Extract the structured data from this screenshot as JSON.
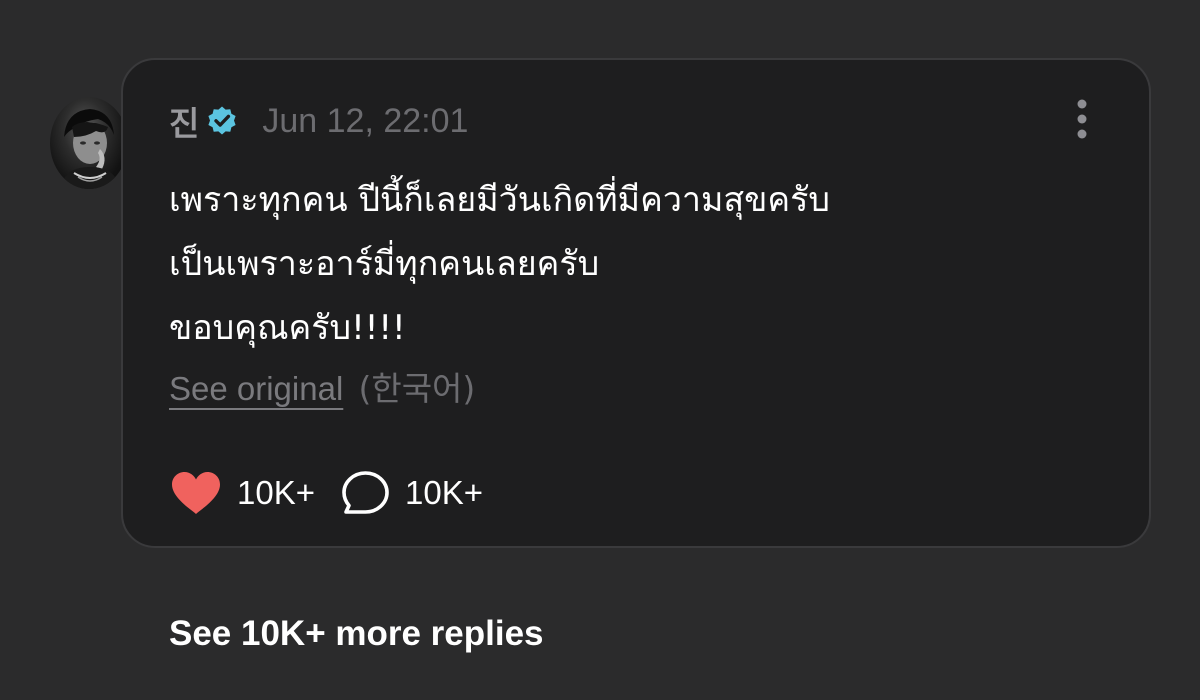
{
  "post": {
    "author": "진",
    "timestamp": "Jun 12, 22:01",
    "lines": [
      "เพราะทุกคน ปีนี้ก็เลยมีวันเกิดที่มีความสุขครับ",
      "เป็นเพราะอาร์มี่ทุกคนเลยครับ",
      "ขอบคุณครับ!!!!"
    ],
    "see_original": "See original",
    "original_language": "(한국어)",
    "like_count": "10K+",
    "comment_count": "10K+"
  },
  "replies": {
    "more_label": "See 10K+ more replies"
  },
  "colors": {
    "background": "#2b2b2c",
    "card": "#1e1e1f",
    "verified": "#5bc4e0",
    "like": "#f0625e"
  },
  "icons": {
    "verified": "verified-badge-icon",
    "more": "more-vertical-icon",
    "like": "heart-icon",
    "comment": "speech-bubble-icon"
  }
}
